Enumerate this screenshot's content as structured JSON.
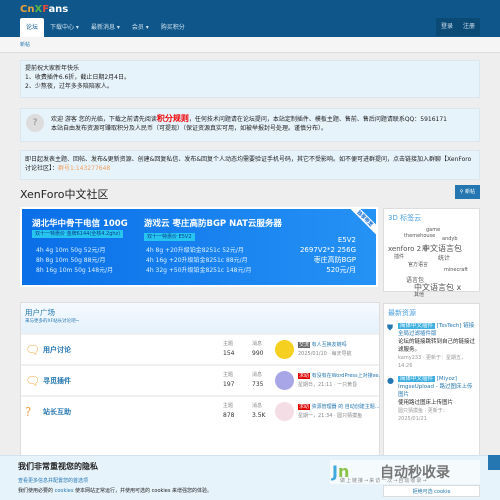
{
  "header": {
    "logo": "CnXFans",
    "nav": [
      "论坛",
      "下载中心 ▾",
      "最新消息 ▾",
      "会员 ▾",
      "购买积分"
    ],
    "login": "登录",
    "register": "注册",
    "subnav": "新帖"
  },
  "notices": {
    "n1": [
      "提前祝大家新年快乐",
      "1、收费插件6.6折，截止日期2月4日。",
      "2、少熬夜，过年多多陪陪家人。"
    ],
    "n2a": "欢迎 游客 您的光临，下载之前请先阅读",
    "n2rule": "积分规则",
    "n2b": "，任何技术问题请在论坛提问，本站定制插件、模板主题、售前、售后问题请联系QQ：5916171",
    "n2c": "本站自由发布资源可赚取积分及人民币（可提现）（保证资源真实可用，如被举报封号处理。谨慎分布）。",
    "n3": "即日起发表主题、回帖、发布&更新资源、创建&回复私信、发布&回复个人动态均需要验证手机号码，其它不受影响。如不便可进群提问，点击链接加入群聊【XenForo讨论社区】：",
    "n3group": "群号1:143277648"
  },
  "main": {
    "title": "XenForo中文社区",
    "new_post": "新帖"
  },
  "banner": {
    "h1": "湖北华中骨干电信 100G",
    "h2": "游戏云 枣庄高防BGP NAT云服务器",
    "tag1": "双十一特惠价 金牌6144(全核4.2ghz)",
    "tag2": "双十一特惠价 E5V2",
    "left": [
      "4h 4g 10m 50g 52元/月",
      "8h 8g 10m 50g 88元/月",
      "8h 16g 10m 50g 148元/月"
    ],
    "mid": [
      "4h 8g +20升级铂金8251c 52元/月",
      "4h 16g +20升级铂金8251c 88元/月",
      "4h 32g +50升级铂金8251c 148元/月"
    ],
    "right": [
      "E5V2",
      "2697V2*2 256G",
      "枣庄高防BGP",
      "520元/月"
    ],
    "ribbon": "独享带宽"
  },
  "section": {
    "title": "用户广场",
    "subtitle": "来与更多的XF站长讨论吧~",
    "threads_label": "主题",
    "posts_label": "消息",
    "rows": [
      {
        "name": "用户讨论",
        "threads": "154",
        "posts": "990",
        "prefix": "交流",
        "prefix_color": "#666666",
        "last": "有人互换友链吗",
        "meta": "2025/01/10 · 每天导航"
      },
      {
        "name": "寻觅插件",
        "threads": "197",
        "posts": "735",
        "prefix": "求助",
        "prefix_color": "#dd0000",
        "last": "有没有在WordPress上对接xe...",
        "meta": "星期日，21:11 · 一只黄昏"
      },
      {
        "name": "站长互助",
        "threads": "878",
        "posts": "3.5K",
        "prefix": "求助",
        "prefix_color": "#dd0000",
        "last": "资源管理器 的 自动创建主题...",
        "meta": "星期一，21:34 · 圆只猜摸鱼"
      }
    ]
  },
  "tagcloud": {
    "title": "3D 标签云",
    "tags": [
      "game",
      "themehouse",
      "andyb",
      "xenforo 2.0",
      "中文语言包",
      "插件",
      "统计",
      "官方语言",
      "minecraft",
      "语言包",
      "中文语言包 x",
      "其他"
    ]
  },
  "resources": {
    "title": "最新资源",
    "items": [
      {
        "tag": "简体中文插件",
        "title": "[TssTech] 链接全局过滤插件版",
        "desc": "论坛的链接跳转到自己的链接过滤服务。",
        "meta": "kamy233 · 更新于：星期五，14:26"
      },
      {
        "tag": "简体中文插件",
        "title": "[Miyoz] ImgseUpload - 路过图床上传图片",
        "desc": "使用路过图床上传图片",
        "meta": "圆只猜摸鱼 · 更新于：2025/01/21"
      }
    ]
  },
  "cookie": {
    "title": "我们非常重视您的隐私",
    "text1": "我们使用必要的",
    "link": "cookies",
    "text2": "使本网站正常运行，并使用可选的 cookies 来增强您的体验。",
    "more": "查看更多信息并配置您的首选项",
    "reject": "拒绝可选 cookie"
  },
  "watermark": {
    "brand": "自动秒收录",
    "slogan": "做上链接→来访一次→自动收录→"
  }
}
